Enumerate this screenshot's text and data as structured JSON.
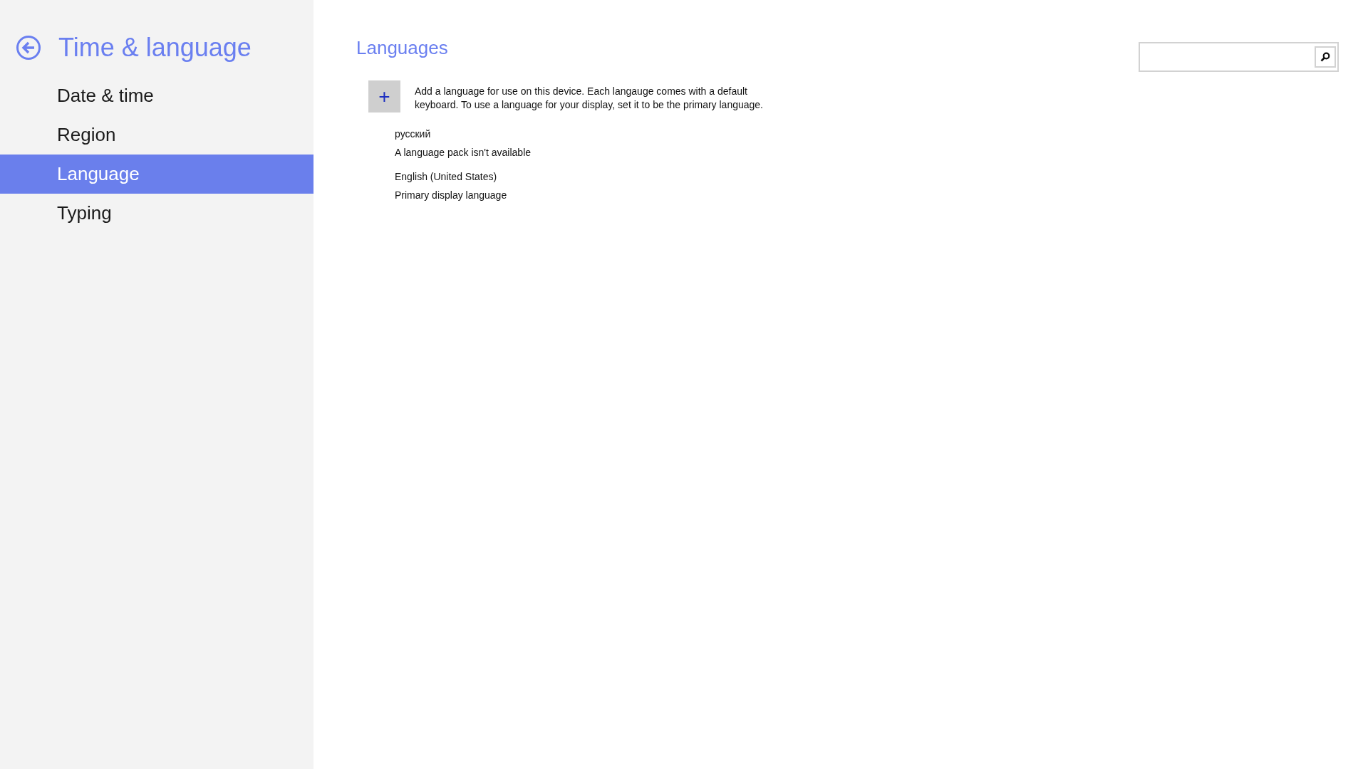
{
  "sidebar": {
    "title": "Time & language",
    "items": [
      {
        "label": "Date & time",
        "selected": false
      },
      {
        "label": "Region",
        "selected": false
      },
      {
        "label": "Language",
        "selected": true
      },
      {
        "label": "Typing",
        "selected": false
      }
    ]
  },
  "content": {
    "heading": "Languages",
    "add_button": "+",
    "description": "Add a language for use on this device. Each langauge comes with a default keyboard. To use a language for your display, set it to be the primary language.",
    "languages": [
      {
        "name": "русский",
        "status": "A language pack isn't available"
      },
      {
        "name": "English (United States)",
        "status": "Primary display language"
      }
    ]
  }
}
